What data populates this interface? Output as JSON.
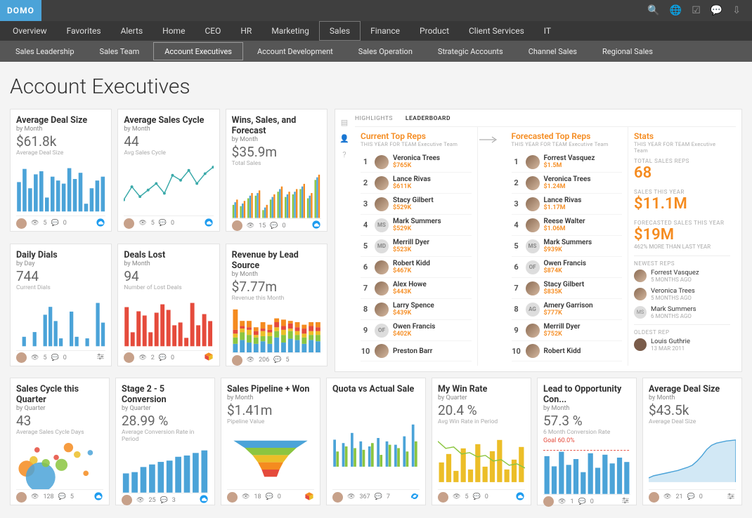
{
  "brand": "DOMO",
  "top_icons": [
    "search-icon",
    "globe-icon",
    "check-icon",
    "chat-icon",
    "download-icon"
  ],
  "nav": [
    "Overview",
    "Favorites",
    "Alerts",
    "Home",
    "CEO",
    "HR",
    "Marketing",
    "Sales",
    "Finance",
    "Product",
    "Client Services",
    "IT"
  ],
  "nav_active": "Sales",
  "subnav": [
    "Sales Leadership",
    "Sales Team",
    "Account Executives",
    "Account Development",
    "Sales Operation",
    "Strategic Accounts",
    "Channel Sales",
    "Regional Sales"
  ],
  "subnav_active": "Account Executives",
  "page_title": "Account Executives",
  "cards_left": [
    {
      "title": "Average Deal Size",
      "sub": "by Month",
      "value": "$61.8k",
      "desc": "Average Deal Size",
      "views": 5,
      "comments": 0,
      "cloud": true,
      "chart": "bars_blue"
    },
    {
      "title": "Average Sales Cycle",
      "sub": "by Month",
      "value": "44",
      "desc": "Avg Sales Cycle",
      "views": 5,
      "comments": 0,
      "cloud": true,
      "chart": "line_teal"
    },
    {
      "title": "Wins, Sales, and Forecast",
      "sub": "by Month",
      "value": "$35.9m",
      "desc": "Total Sales",
      "views": 15,
      "comments": 0,
      "cloud": true,
      "chart": "grouped_bars"
    },
    {
      "title": "Daily Dials",
      "sub": "by Day",
      "value": "744",
      "desc": "Current Dials",
      "views": 5,
      "comments": 0,
      "controls": true,
      "chart": "sparse_bars"
    },
    {
      "title": "Deals Lost",
      "sub": "by Month",
      "value": "94",
      "desc": "Number of Lost Deals",
      "views": 2,
      "comments": 0,
      "cube": true,
      "chart": "bars_red"
    },
    {
      "title": "Revenue by Lead Source",
      "sub": "by Month",
      "value": "$7.77m",
      "desc": "Revenue this Month",
      "views": 206,
      "comments": 5,
      "chart": "stacked_bars"
    }
  ],
  "cards_bottom": [
    {
      "title": "Sales Cycle this Quarter",
      "sub": "by Quarter",
      "value": "43",
      "desc": "Average Sales Cycle Days",
      "views": 128,
      "comments": 5,
      "cloud": true,
      "chart": "scatter"
    },
    {
      "title": "Stage 2 - 5 Conversion",
      "sub": "by Quarter",
      "value": "28.99 %",
      "desc": "Average Conversion Rate in Period",
      "views": 25,
      "comments": 3,
      "cloud": true,
      "chart": "bars_blue2"
    },
    {
      "title": "Sales Pipeline + Won",
      "sub": "by Month",
      "value": "$1.41m",
      "desc": "Pipeline Value",
      "views": 18,
      "comments": 0,
      "cube": true,
      "chart": "funnel"
    },
    {
      "title": "Quota vs Actual Sale",
      "sub": "",
      "value": "",
      "desc": "",
      "views": 367,
      "comments": 7,
      "sync": true,
      "chart": "grouped_small"
    },
    {
      "title": "My Win Rate",
      "sub": "by Quarter",
      "value": "20.4 %",
      "desc": "Avg Win Rate in Period",
      "views": 5,
      "comments": 0,
      "cloud": true,
      "chart": "bars_line_yellow"
    },
    {
      "title": "Lead to Opportunity Con...",
      "sub": "by Month",
      "value": "57.3 %",
      "desc": "6 Month Conversion Rate",
      "goal": "Goal 60.0%",
      "views": 1,
      "comments": 0,
      "controls": true,
      "chart": "goal_bars"
    },
    {
      "title": "Average Deal Size",
      "sub": "by Month",
      "value": "$43.5k",
      "desc": "Average Deal Size",
      "views": 21,
      "comments": 0,
      "controls": true,
      "chart": "step_line"
    }
  ],
  "right_panel": {
    "tabs": [
      "HIGHLIGHTS",
      "LEADERBOARD"
    ],
    "tab_active": "LEADERBOARD",
    "col1_title": "Current Top Reps",
    "col_subtitle": "THIS YEAR FOR TEAM Executive Team",
    "col2_title": "Forecasted Top Reps",
    "col3_title": "Stats",
    "current_reps": [
      {
        "rank": 1,
        "name": "Veronica Trees",
        "value": "$765K",
        "av": "img"
      },
      {
        "rank": 2,
        "name": "Lance Rivas",
        "value": "$611K",
        "av": "img"
      },
      {
        "rank": 3,
        "name": "Stacy Gilbert",
        "value": "$529K",
        "av": "img"
      },
      {
        "rank": 4,
        "name": "Mark Summers",
        "value": "$529K",
        "av": "MS"
      },
      {
        "rank": 5,
        "name": "Merrill Dyer",
        "value": "$523K",
        "av": "MD"
      },
      {
        "rank": 6,
        "name": "Robert Kidd",
        "value": "$467K",
        "av": "img"
      },
      {
        "rank": 7,
        "name": "Alex Howe",
        "value": "$443K",
        "av": "img"
      },
      {
        "rank": 8,
        "name": "Larry Spence",
        "value": "$439K",
        "av": "img"
      },
      {
        "rank": 9,
        "name": "Owen Francis",
        "value": "$402K",
        "av": "OF"
      },
      {
        "rank": 10,
        "name": "Preston Barr",
        "value": "",
        "av": "img"
      }
    ],
    "forecast_reps": [
      {
        "rank": 1,
        "name": "Forrest Vasquez",
        "value": "$1.5M",
        "av": "img"
      },
      {
        "rank": 2,
        "name": "Veronica Trees",
        "value": "$1.24M",
        "av": "img"
      },
      {
        "rank": 3,
        "name": "Lance Rivas",
        "value": "$1.17M",
        "av": "img"
      },
      {
        "rank": 4,
        "name": "Reese Walter",
        "value": "$1.06M",
        "av": "img"
      },
      {
        "rank": 5,
        "name": "Mark Summers",
        "value": "$939K",
        "av": "MS"
      },
      {
        "rank": 6,
        "name": "Owen Francis",
        "value": "$874K",
        "av": "OF"
      },
      {
        "rank": 7,
        "name": "Stacy Gilbert",
        "value": "$835K",
        "av": "img"
      },
      {
        "rank": 8,
        "name": "Amery Garrison",
        "value": "$777K",
        "av": "AG"
      },
      {
        "rank": 9,
        "name": "Merrill Dyer",
        "value": "$752K",
        "av": "img"
      },
      {
        "rank": 10,
        "name": "Robert Kidd",
        "value": "",
        "av": "img"
      }
    ],
    "stats": {
      "total_reps_label": "TOTAL SALES REPS",
      "total_reps": "68",
      "sales_year_label": "SALES THIS YEAR",
      "sales_year": "$11.1M",
      "forecast_label": "FORECASTED SALES THIS YEAR",
      "forecast": "$19M",
      "forecast_sub": "462% MORE THAN LAST YEAR",
      "newest_label": "NEWEST REPS",
      "newest": [
        {
          "name": "Forrest Vasquez",
          "sub": "5 MONTHS AGO"
        },
        {
          "name": "Veronica Trees",
          "sub": "5 MONTHS AGO"
        },
        {
          "name": "Mark Summers",
          "sub": "6 MONTHS AGO",
          "av": "MS"
        }
      ],
      "oldest_label": "OLDEST REP",
      "oldest": {
        "name": "Louis Guthrie",
        "sub": "13 MAR 2011"
      }
    }
  },
  "chart_data": {
    "bars_blue": {
      "type": "bar",
      "values": [
        38,
        55,
        30,
        48,
        52,
        18,
        45,
        40,
        36,
        56,
        42,
        50,
        10,
        30,
        40,
        45
      ],
      "color": "#4ba3d8"
    },
    "line_teal": {
      "type": "line",
      "values": [
        40,
        48,
        42,
        46,
        50,
        44,
        55,
        52,
        58,
        50,
        56,
        60
      ],
      "color": "#3aa9a9"
    },
    "grouped_bars": {
      "type": "bar-group",
      "series": [
        {
          "color": "#8bc540",
          "values": [
            20,
            18,
            30,
            34,
            12,
            28,
            40,
            32,
            36,
            44,
            30,
            58
          ]
        },
        {
          "color": "#4ba3d8",
          "values": [
            24,
            22,
            34,
            38,
            16,
            32,
            44,
            36,
            40,
            48,
            34,
            62
          ]
        },
        {
          "color": "#f58b1f",
          "values": [
            28,
            26,
            38,
            42,
            20,
            36,
            48,
            40,
            44,
            52,
            38,
            66
          ]
        }
      ]
    },
    "sparse_bars": {
      "type": "bar",
      "values": [
        0,
        12,
        0,
        18,
        0,
        40,
        50,
        32,
        10,
        0,
        44,
        12,
        0,
        10,
        0,
        55,
        30
      ],
      "color": "#4ba3d8"
    },
    "bars_red": {
      "type": "bar",
      "values": [
        56,
        20,
        50,
        44,
        20,
        48,
        60,
        52,
        30,
        34,
        12,
        62,
        30,
        46,
        36
      ],
      "color": "#e54b3c"
    },
    "stacked_bars": {
      "type": "bar-stack",
      "series": [
        {
          "color": "#4ba3d8",
          "values": [
            14,
            20,
            16,
            14,
            18,
            14,
            24,
            16,
            22,
            20,
            14,
            20,
            18
          ]
        },
        {
          "color": "#8bc540",
          "values": [
            10,
            12,
            12,
            10,
            8,
            12,
            10,
            12,
            12,
            8,
            10,
            8,
            10
          ]
        },
        {
          "color": "#ecbe28",
          "values": [
            6,
            6,
            8,
            4,
            8,
            6,
            6,
            8,
            4,
            6,
            6,
            6,
            6
          ]
        },
        {
          "color": "#e54b3c",
          "values": [
            6,
            4,
            4,
            6,
            4,
            4,
            8,
            6,
            8,
            6,
            8,
            8,
            6
          ]
        },
        {
          "color": "#f58b1f",
          "values": [
            32,
            8,
            10,
            6,
            10,
            8,
            6,
            10,
            4,
            8,
            6,
            6,
            8
          ]
        }
      ]
    },
    "scatter": {
      "type": "scatter",
      "points": [
        [
          12,
          40,
          12,
          "#f58b1f"
        ],
        [
          20,
          58,
          6,
          "#ecbe28"
        ],
        [
          24,
          80,
          4,
          "#e54b3c"
        ],
        [
          28,
          22,
          22,
          "#4ba3d8"
        ],
        [
          34,
          52,
          6,
          "#8bc540"
        ],
        [
          46,
          64,
          4,
          "#e54b3c"
        ],
        [
          52,
          48,
          9,
          "#8bc540"
        ],
        [
          70,
          70,
          5,
          "#ecbe28"
        ],
        [
          80,
          30,
          4,
          "#f58b1f"
        ],
        [
          85,
          74,
          4,
          "#4ba3d8"
        ],
        [
          60,
          85,
          7,
          "#f58b1f"
        ]
      ]
    },
    "bars_blue2": {
      "type": "bar",
      "values": [
        30,
        32,
        40,
        44,
        48,
        50,
        56,
        58,
        62,
        66
      ],
      "color": "#4ba3d8"
    },
    "funnel": {
      "type": "funnel",
      "colors": [
        "#4ba3d8",
        "#8bc540",
        "#ecbe28",
        "#f58b1f",
        "#e54b3c"
      ]
    },
    "grouped_small": {
      "type": "bar-group",
      "series": [
        {
          "color": "#4ba3d8",
          "values": [
            32,
            28,
            40,
            30,
            24,
            34,
            30,
            26,
            36,
            50
          ]
        },
        {
          "color": "#8bc540",
          "values": [
            18,
            24,
            22,
            20,
            28,
            14,
            26,
            22,
            18,
            30
          ]
        }
      ]
    },
    "bars_line_yellow": {
      "type": "bar-line",
      "bars": [
        28,
        40,
        16,
        48,
        18,
        54,
        22,
        44,
        60,
        18,
        32,
        50
      ],
      "bar_color": "#ecbe28",
      "line": [
        58,
        48,
        50,
        40,
        42,
        36,
        38,
        30,
        32,
        24,
        26,
        20
      ],
      "line_color": "#8bc540"
    },
    "goal_bars": {
      "type": "bar",
      "values": [
        52,
        38,
        58,
        40,
        48,
        30,
        56,
        36,
        54,
        42,
        50,
        44
      ],
      "color": "#4ba3d8",
      "goal": 60,
      "goal_color": "#e54b3c"
    },
    "step_line": {
      "type": "area-step",
      "values": [
        8,
        12,
        14,
        16,
        18,
        20,
        22,
        25,
        28,
        32,
        40,
        50,
        62,
        70,
        74,
        76,
        78,
        79,
        80
      ],
      "color": "#4ba3d8"
    }
  }
}
